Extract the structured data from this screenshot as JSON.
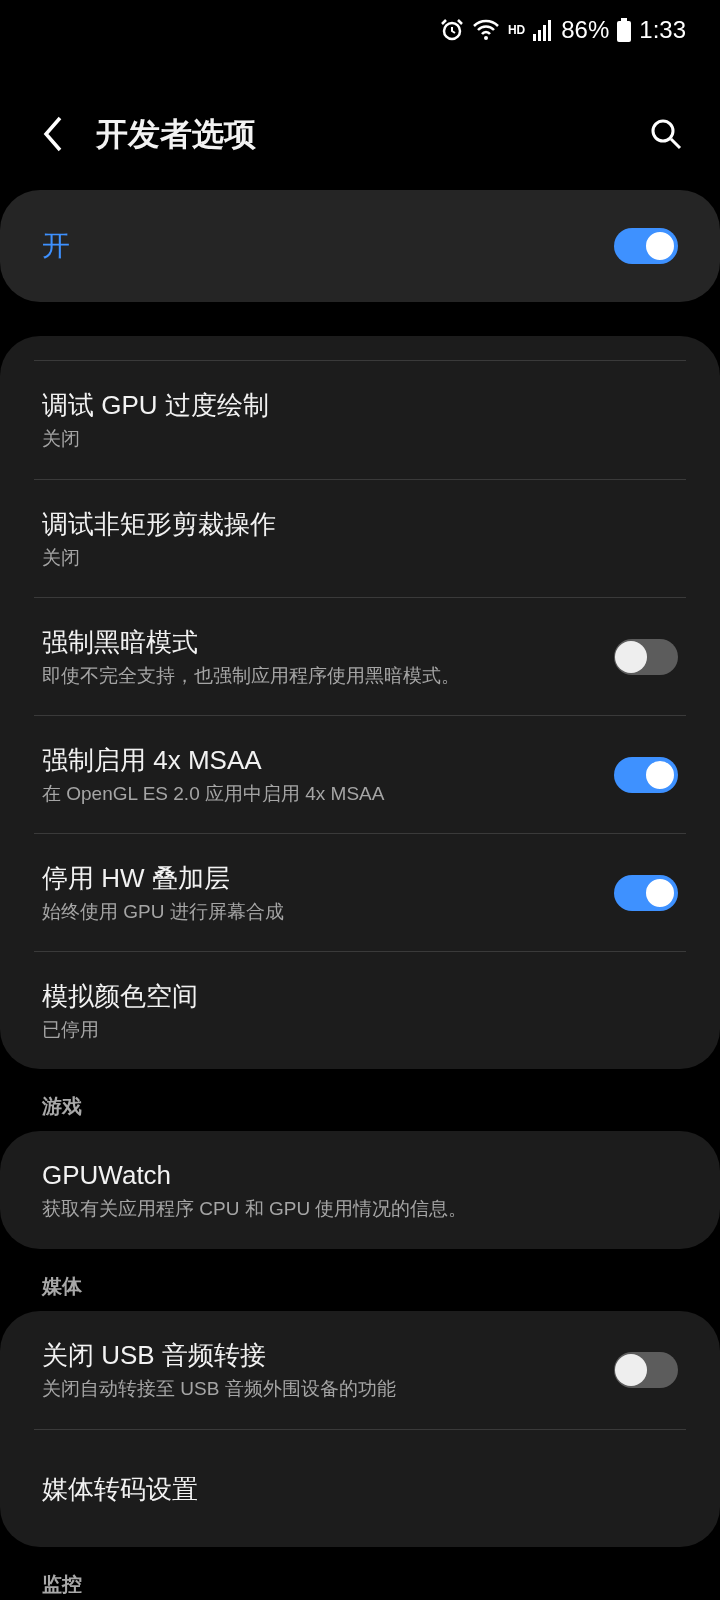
{
  "status_bar": {
    "hd": "HD",
    "battery": "86%",
    "time": "1:33"
  },
  "header": {
    "title": "开发者选项"
  },
  "master": {
    "label": "开",
    "on": true
  },
  "groups": [
    {
      "items": [
        {
          "kind": "text",
          "title": "调试 GPU 过度绘制",
          "subtitle": "关闭"
        },
        {
          "kind": "text",
          "title": "调试非矩形剪裁操作",
          "subtitle": "关闭"
        },
        {
          "kind": "toggle",
          "title": "强制黑暗模式",
          "subtitle": "即使不完全支持，也强制应用程序使用黑暗模式。",
          "on": false
        },
        {
          "kind": "toggle",
          "title": "强制启用 4x MSAA",
          "subtitle": "在 OpenGL ES 2.0 应用中启用 4x MSAA",
          "on": true
        },
        {
          "kind": "toggle",
          "title": "停用 HW 叠加层",
          "subtitle": "始终使用 GPU 进行屏幕合成",
          "on": true
        },
        {
          "kind": "text",
          "title": "模拟颜色空间",
          "subtitle": "已停用"
        }
      ]
    },
    {
      "heading": "游戏",
      "items": [
        {
          "kind": "text",
          "title": "GPUWatch",
          "subtitle": "获取有关应用程序 CPU 和 GPU 使用情况的信息。"
        }
      ]
    },
    {
      "heading": "媒体",
      "items": [
        {
          "kind": "toggle",
          "title": "关闭 USB 音频转接",
          "subtitle": "关闭自动转接至 USB 音频外围设备的功能",
          "on": false
        },
        {
          "kind": "text",
          "title": "媒体转码设置"
        }
      ]
    },
    {
      "heading": "监控"
    }
  ]
}
